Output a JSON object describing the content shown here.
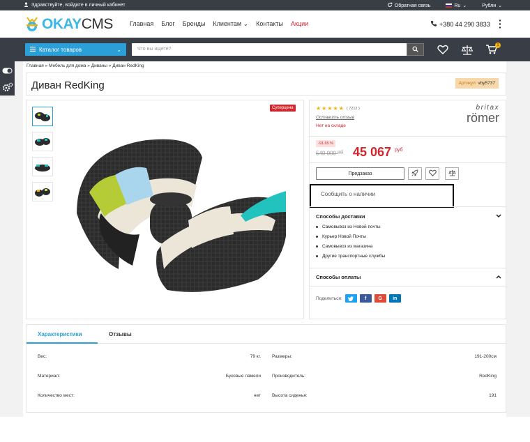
{
  "topbar": {
    "greeting": "Здравствуйте, войдите в личный кабинет",
    "callback": "Обратная связь",
    "language": "Ru",
    "currency": "Рубли"
  },
  "header": {
    "logo_okay": "OKAY",
    "logo_cms": "CMS",
    "nav": [
      "Главная",
      "Блог",
      "Бренды",
      "Клиентам",
      "Контакты",
      "Акции"
    ],
    "phone": "+380 44 290 3833"
  },
  "searchbar": {
    "catalog_label": "Каталог товаров",
    "search_placeholder": "Что вы ищете?",
    "cart_count": "1"
  },
  "breadcrumb": [
    "Главная",
    "Мебель для дома",
    "Диваны",
    "Диван RedKing"
  ],
  "product": {
    "title": "Диван RedKing",
    "sku_label": "Артикул:",
    "sku": "vby5737",
    "badge": "Суперцена",
    "rating_count": "( 7212 )",
    "review_link": "Оставить отзыв",
    "stock": "Нет на складе",
    "brand_top": "britax",
    "brand_bottom": "römer",
    "discount": "-91.65 %",
    "old_price": "540 000",
    "old_currency": "руб",
    "price": "45 067",
    "price_currency": "руб",
    "preorder": "Предзаказ",
    "notify": "Сообщить о наличии",
    "delivery_title": "Способы доставки",
    "delivery": [
      "Самовывоз из Новой почты",
      "Курьер Новой Почты",
      "Самовывоз из магазина",
      "Другие транспортные службы"
    ],
    "payment_title": "Способы оплаты",
    "share_label": "Поделиться:"
  },
  "tabs": {
    "features": "Характеристики",
    "reviews": "Отзывы"
  },
  "specs": [
    {
      "label": "Вес:",
      "value": "79 кг."
    },
    {
      "label": "Размеры:",
      "value": "191-200см"
    },
    {
      "label": "Материал:",
      "value": "Буковые ламели"
    },
    {
      "label": "Производитель:",
      "value": "RedKing"
    },
    {
      "label": "Количество мест:",
      "value": "нет"
    },
    {
      "label": "Высота сиденья:",
      "value": "191"
    }
  ],
  "colors": {
    "accent": "#2a9fd8",
    "dark": "#393e46",
    "sale": "#d0262e",
    "star": "#f2b10e"
  }
}
